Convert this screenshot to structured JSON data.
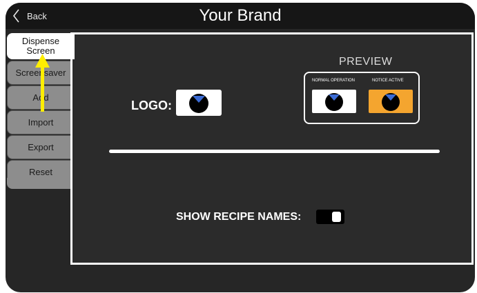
{
  "header": {
    "back_label": "Back",
    "title": "Your Brand"
  },
  "sidebar": {
    "tabs": [
      {
        "label": "Dispense Screen",
        "active": true
      },
      {
        "label": "Screensaver",
        "active": false
      },
      {
        "label": "Add",
        "active": false
      },
      {
        "label": "Import",
        "active": false
      },
      {
        "label": "Export",
        "active": false
      },
      {
        "label": "Reset",
        "active": false
      }
    ]
  },
  "brand": {
    "logo_label": "LOGO:",
    "preview_label": "PREVIEW",
    "preview_normal_caption": "NORMAL OPERATION",
    "preview_notice_caption": "NOTICE ACTIVE",
    "show_recipe_names_label": "SHOW RECIPE NAMES:",
    "show_recipe_names_enabled": true
  },
  "colors": {
    "notice_color": "#f4a52f",
    "logo_blue": "#3b6bd4",
    "annotation_arrow": "#ffee00"
  },
  "icons": {
    "back": "chevron-left-icon",
    "logo": "brand-logo-icon",
    "annotation": "up-arrow-icon"
  }
}
